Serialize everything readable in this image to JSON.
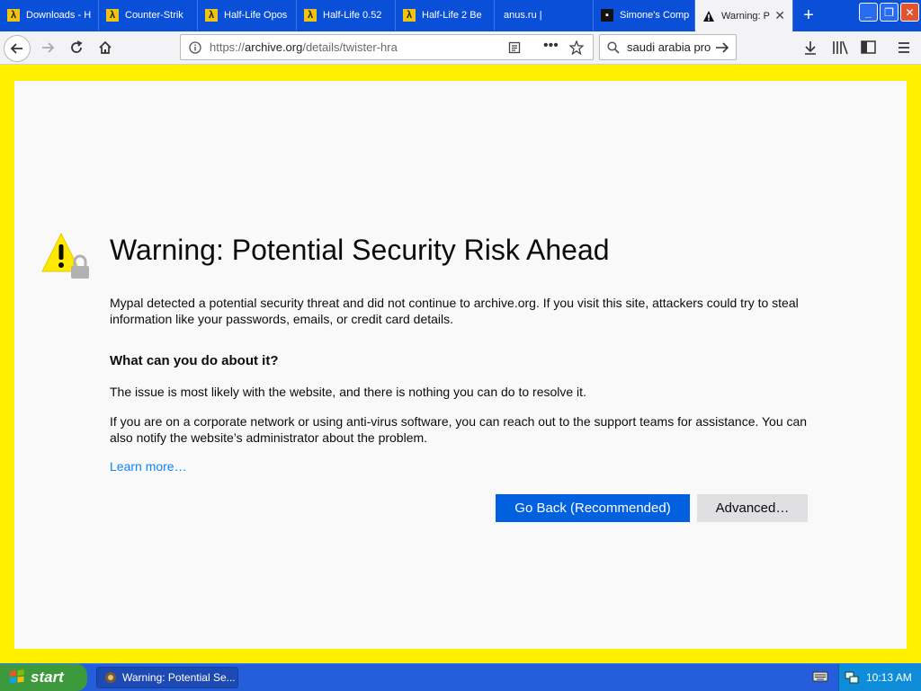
{
  "tabs": [
    {
      "label": "Downloads - H",
      "icon": "half-life-lambda-icon"
    },
    {
      "label": "Counter-Strik",
      "icon": "half-life-lambda-icon"
    },
    {
      "label": "Half-Life Opos",
      "icon": "half-life-lambda-icon"
    },
    {
      "label": "Half-Life 0.52",
      "icon": "half-life-lambda-icon"
    },
    {
      "label": "Half-Life 2 Be",
      "icon": "half-life-lambda-icon"
    },
    {
      "label": "anus.ru |",
      "icon": ""
    },
    {
      "label": "Simone's Comp",
      "icon": "site-favicon-dark"
    },
    {
      "label": "Warning: P",
      "icon": "warning-icon",
      "active": true
    }
  ],
  "window_controls": {
    "min": "_",
    "max": "❐",
    "close": "✕"
  },
  "navbar": {
    "url_prefix": "https://",
    "url_host": "archive.org",
    "url_path": "/details/twister-hra",
    "search_value": "saudi arabia pro"
  },
  "page": {
    "title": "Warning: Potential Security Risk Ahead",
    "p1": "Mypal detected a potential security threat and did not continue to archive.org. If you visit this site, attackers could try to steal information like your passwords, emails, or credit card details.",
    "heading": "What can you do about it?",
    "p2": "The issue is most likely with the website, and there is nothing you can do to resolve it.",
    "p3": "If you are on a corporate network or using anti-virus software, you can reach out to the support teams for assistance. You can also notify the website’s administrator about the problem.",
    "learn_more": "Learn more…",
    "go_back": "Go Back (Recommended)",
    "advanced": "Advanced…"
  },
  "taskbar": {
    "start": "start",
    "item": "Warning: Potential Se...",
    "clock": "10:13 AM"
  },
  "colors": {
    "frame": "#fff000",
    "primary_button": "#0060df",
    "link": "#0a84ff"
  }
}
